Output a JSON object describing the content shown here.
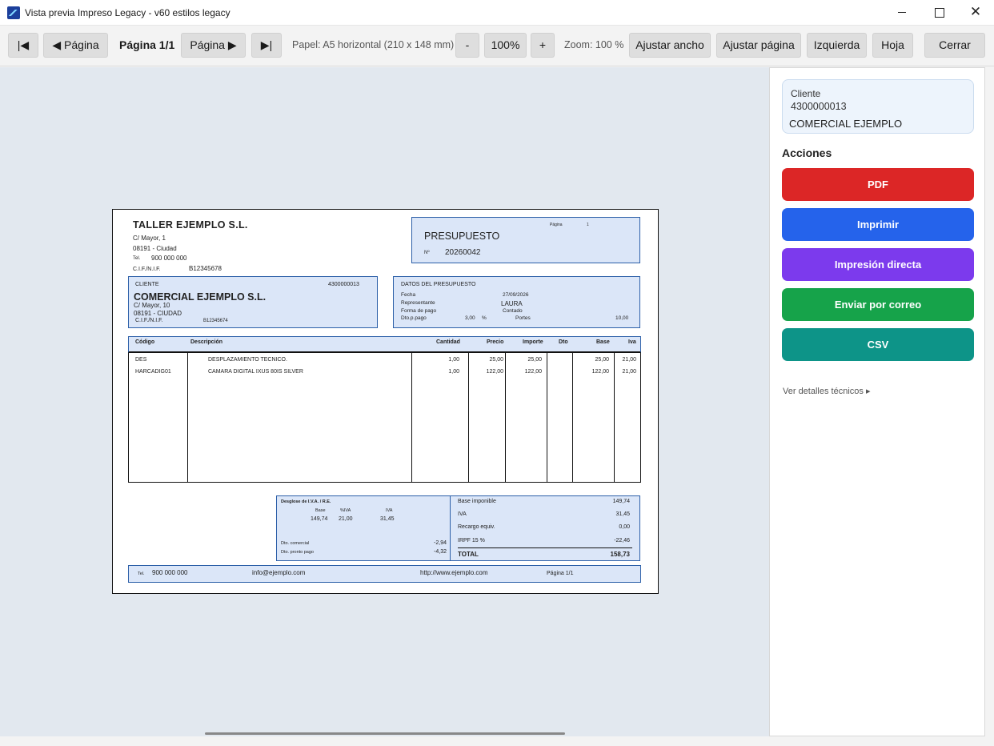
{
  "window": {
    "title": "Vista previa Impreso Legacy - v60 estilos legacy",
    "minimize": "—",
    "maximize": "☐",
    "close": "✕"
  },
  "toolbar": {
    "first": "|◀",
    "prev": "◀ Página",
    "page_indicator": "Página 1/1",
    "next": "Página ▶",
    "last": "▶|",
    "paper": "Papel: A5 horizontal (210 x 148 mm)",
    "zoom_out": "-",
    "zoom_value": "100%",
    "zoom_in": "+",
    "zoom_label": "Zoom: 100 %",
    "fit_width": "Ajustar ancho",
    "fit_page": "Ajustar página",
    "left": "Izquierda",
    "sheet": "Hoja",
    "close": "Cerrar"
  },
  "document": {
    "company": {
      "name": "TALLER EJEMPLO S.L.",
      "address": "C/ Mayor, 1",
      "city": "08191 - Ciudad",
      "tel_label": "Tel.",
      "tel": "900 000 000",
      "cif_label": "C.I.F./N.I.F.",
      "cif": "B12345678"
    },
    "header_box": {
      "title": "PRESUPUESTO",
      "page_label": "Página",
      "page": "1",
      "num_label": "Nº",
      "number": "20260042"
    },
    "client": {
      "label": "CLIENTE",
      "code": "4300000013",
      "name": "COMERCIAL EJEMPLO S.L.",
      "address": "C/ Mayor, 10",
      "city": "08191 - CIUDAD",
      "cif_label": "C.I.F./N.I.F.",
      "cif": "B12345674"
    },
    "data_box": {
      "label": "DATOS DEL PRESUPUESTO",
      "fecha_label": "Fecha",
      "fecha": "27/09/2026",
      "rep_label": "Representante",
      "rep": "LAURA",
      "pago_label": "Forma de pago",
      "pago": "Contado",
      "dto_label": "Dto.p.pago",
      "dto": "3,00",
      "pct": "%",
      "portes_label": "Portes",
      "portes": "10,00"
    },
    "columns": [
      "Código",
      "Descripción",
      "Cantidad",
      "Precio",
      "Importe",
      "Dto",
      "Base",
      "Iva"
    ],
    "lines": [
      {
        "code": "DES",
        "desc": "DESPLAZAMIENTO TECNICO.",
        "qty": "1,00",
        "price": "25,00",
        "amount": "25,00",
        "dto": "",
        "base": "25,00",
        "iva": "21,00"
      },
      {
        "code": "HARCADIG01",
        "desc": "CAMARA DIGITAL IXUS 80IS SILVER",
        "qty": "1,00",
        "price": "122,00",
        "amount": "122,00",
        "dto": "",
        "base": "122,00",
        "iva": "21,00"
      }
    ],
    "vat": {
      "title": "Desglose de I.V.A. / R.E.",
      "base_h": "Base",
      "pct_h": "%IVA",
      "iva_h": "IVA",
      "base": "149,74",
      "pct": "21,00",
      "iva": "31,45",
      "dto_com_label": "Dto. comercial",
      "dto_com": "-2,94",
      "dto_pp_label": "Dto. pronto pago",
      "dto_pp": "-4,32"
    },
    "totals": {
      "base_label": "Base imponible",
      "base": "149,74",
      "iva_label": "IVA",
      "iva": "31,45",
      "recargo_label": "Recargo equiv.",
      "recargo": "0,00",
      "irpf_label": "IRPF 15 %",
      "irpf": "-22,46",
      "total_label": "TOTAL",
      "total": "158,73"
    },
    "footer": {
      "tel_label": "Tel.",
      "tel": "900 000 000",
      "email": "info@ejemplo.com",
      "web": "http://www.ejemplo.com",
      "page": "Página 1/1"
    }
  },
  "sidebar": {
    "client_label": "Cliente",
    "client_code": "4300000013",
    "client_name": "COMERCIAL EJEMPLO",
    "actions_title": "Acciones",
    "actions": [
      {
        "label": "PDF",
        "color": "#dc2626"
      },
      {
        "label": "Imprimir",
        "color": "#2563eb"
      },
      {
        "label": "Impresión directa",
        "color": "#7c3aed"
      },
      {
        "label": "Enviar por correo",
        "color": "#16a34a"
      },
      {
        "label": "CSV",
        "color": "#0d9488"
      }
    ],
    "details_link": "Ver detalles técnicos ▸"
  }
}
